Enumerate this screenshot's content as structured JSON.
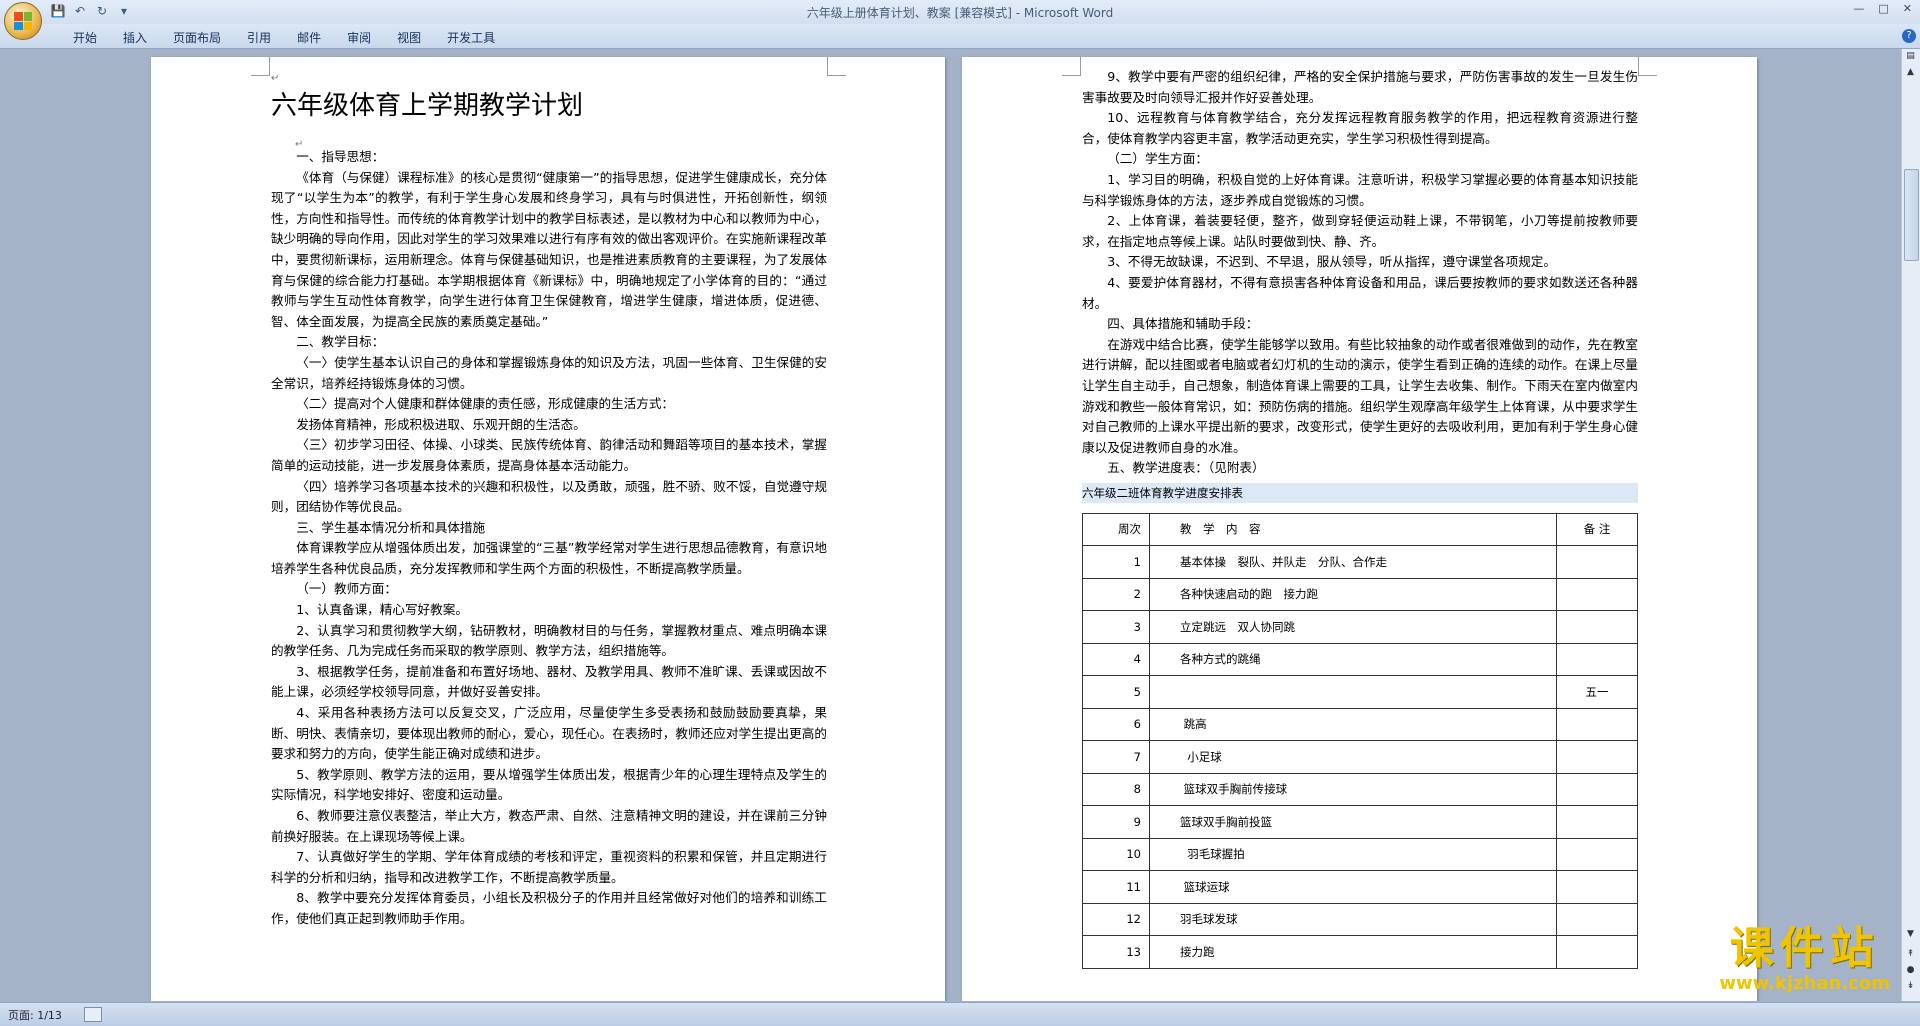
{
  "window": {
    "title": "六年级上册体育计划、教案 [兼容模式] - Microsoft Word"
  },
  "ribbon": {
    "tabs": [
      "开始",
      "插入",
      "页面布局",
      "引用",
      "邮件",
      "审阅",
      "视图",
      "开发工具"
    ]
  },
  "page1": {
    "title": "六年级体育上学期教学计划",
    "paragraphs": [
      "一、指导思想：",
      "《体育（与保健）课程标准》的核心是贯彻“健康第一”的指导思想，促进学生健康成长，充分体现了“以学生为本”的教学，有利于学生身心发展和终身学习，具有与时俱进性，开拓创新性，纲领性，方向性和指导性。而传统的体育教学计划中的教学目标表述，是以教材为中心和以教师为中心，缺少明确的导向作用，因此对学生的学习效果难以进行有序有效的做出客观评价。在实施新课程改革中，要贯彻新课标，运用新理念。体育与保健基础知识，也是推进素质教育的主要课程，为了发展体育与保健的综合能力打基础。本学期根据体育《新课标》中，明确地规定了小学体育的目的：“通过教师与学生互动性体育教学，向学生进行体育卫生保健教育，增进学生健康，增进体质，促进德、智、体全面发展，为提高全民族的素质奠定基础。”",
      "二、教学目标：",
      "〈一〉使学生基本认识自己的身体和掌握锻炼身体的知识及方法，巩固一些体育、卫生保健的安全常识，培养经持锻炼身体的习惯。",
      "〈二〉提高对个人健康和群体健康的责任感，形成健康的生活方式：",
      "发扬体育精神，形成积极进取、乐观开朗的生活态。",
      "〈三〉初步学习田径、体操、小球类、民族传统体育、韵律活动和舞蹈等项目的基本技术，掌握简单的运动技能，进一步发展身体素质，提高身体基本活动能力。",
      "〈四〉培养学习各项基本技术的兴趣和积极性，以及勇敢，顽强，胜不骄、败不馁，自觉遵守规则，团结协作等优良品。",
      "三、学生基本情况分析和具体措施",
      "体育课教学应从增强体质出发，加强课堂的“三基”教学经常对学生进行思想品德教育，有意识地培养学生各种优良品质，充分发挥教师和学生两个方面的积极性，不断提高教学质量。",
      "（一）教师方面：",
      "1、认真备课，精心写好教案。",
      "2、认真学习和贯彻教学大纲，钻研教材，明确教材目的与任务，掌握教材重点、难点明确本课的教学任务、几为完成任务而采取的教学原则、教学方法，组织措施等。",
      "3、根据教学任务，提前准备和布置好场地、器材、及教学用具、教师不准旷课、丢课或因故不能上课，必须经学校领导同意，并做好妥善安排。",
      "4、采用各种表扬方法可以反复交叉，广泛应用，尽量使学生多受表扬和鼓励鼓励要真挚，果断、明快、表情亲切，要体现出教师的耐心，爱心，现任心。在表扬时，教师还应对学生提出更高的要求和努力的方向，使学生能正确对成绩和进步。",
      "5、教学原则、教学方法的运用，要从增强学生体质出发，根据青少年的心理生理特点及学生的实际情况，科学地安排好、密度和运动量。",
      "6、教师要注意仪表整洁，举止大方，教态严肃、自然、注意精神文明的建设，并在课前三分钟前换好服装。在上课现场等候上课。",
      "7、认真做好学生的学期、学年体育成绩的考核和评定，重视资料的积累和保管，并且定期进行科学的分析和归纳，指导和改进教学工作，不断提高教学质量。",
      "8、教学中要充分发挥体育委员，小组长及积极分子的作用并且经常做好对他们的培养和训练工作，使他们真正起到教师助手作用。"
    ]
  },
  "page2": {
    "paragraphs": [
      "9、教学中要有严密的组织纪律，严格的安全保护措施与要求，严防伤害事故的发生一旦发生伤害事故要及时向领导汇报并作好妥善处理。",
      "10、远程教育与体育教学结合，充分发挥远程教育服务教学的作用，把远程教育资源进行整合，使体育教学内容更丰富，教学活动更充实，学生学习积极性得到提高。",
      "（二）学生方面：",
      "1、学习目的明确，积极自觉的上好体育课。注意听讲，积极学习掌握必要的体育基本知识技能与科学锻炼身体的方法，逐步养成自觉锻炼的习惯。",
      "2、上体育课，着装要轻便，整齐，做到穿轻便运动鞋上课，不带钢笔，小刀等提前按教师要求，在指定地点等候上课。站队时要做到快、静、齐。",
      "3、不得无故缺课，不迟到、不早退，服从领导，听从指挥，遵守课堂各项规定。",
      "4、要爱护体育器材，不得有意损害各种体育设备和用品，课后要按教师的要求如数送还各种器材。",
      "四、具体措施和辅助手段：",
      "在游戏中结合比赛，使学生能够学以致用。有些比较抽象的动作或者很难做到的动作，先在教室进行讲解，配以挂图或者电脑或者幻灯机的生动的演示，使学生看到正确的连续的动作。在课上尽量让学生自主动手，自己想象，制造体育课上需要的工具，让学生去收集、制作。下雨天在室内做室内游戏和教些一般体育常识，如：预防伤病的措施。组织学生观摩高年级学生上体育课，从中要求学生对自己教师的上课水平提出新的要求，改变形式，使学生更好的去吸收利用，更加有利于学生身心健康以及促进教师自身的水准。",
      "五、教学进度表：（见附表）"
    ],
    "table_title": "六年级二班体育教学进度安排表",
    "table_header": {
      "week": "周次",
      "content": "教　学　内　容",
      "note": "备 注"
    },
    "table_rows": [
      {
        "week": "1",
        "content": "基本体操　裂队、并队走　分队、合作走",
        "note": ""
      },
      {
        "week": "2",
        "content": "各种快速启动的跑　接力跑",
        "note": ""
      },
      {
        "week": "3",
        "content": "立定跳远　双人协同跳",
        "note": ""
      },
      {
        "week": "4",
        "content": "各种方式的跳绳",
        "note": ""
      },
      {
        "week": "5",
        "content": "",
        "note": "五一"
      },
      {
        "week": "6",
        "content": " 跳高",
        "note": ""
      },
      {
        "week": "7",
        "content": "  小足球",
        "note": ""
      },
      {
        "week": "8",
        "content": " 篮球双手胸前传接球",
        "note": ""
      },
      {
        "week": "9",
        "content": "篮球双手胸前投篮",
        "note": ""
      },
      {
        "week": "10",
        "content": "  羽毛球握拍",
        "note": ""
      },
      {
        "week": "11",
        "content": " 篮球运球",
        "note": ""
      },
      {
        "week": "12",
        "content": "羽毛球发球",
        "note": ""
      },
      {
        "week": "13",
        "content": "接力跑",
        "note": ""
      }
    ]
  },
  "status": {
    "page_info": "页面: 1/13"
  },
  "watermark": {
    "line1": "课件站",
    "line2": "www.kjzhan.com"
  },
  "colors": {
    "title_bar": "#d2dff0",
    "workspace": "#a4b3c8",
    "table_title_bg": "#dbe8f5",
    "watermark": "#f0c400"
  }
}
